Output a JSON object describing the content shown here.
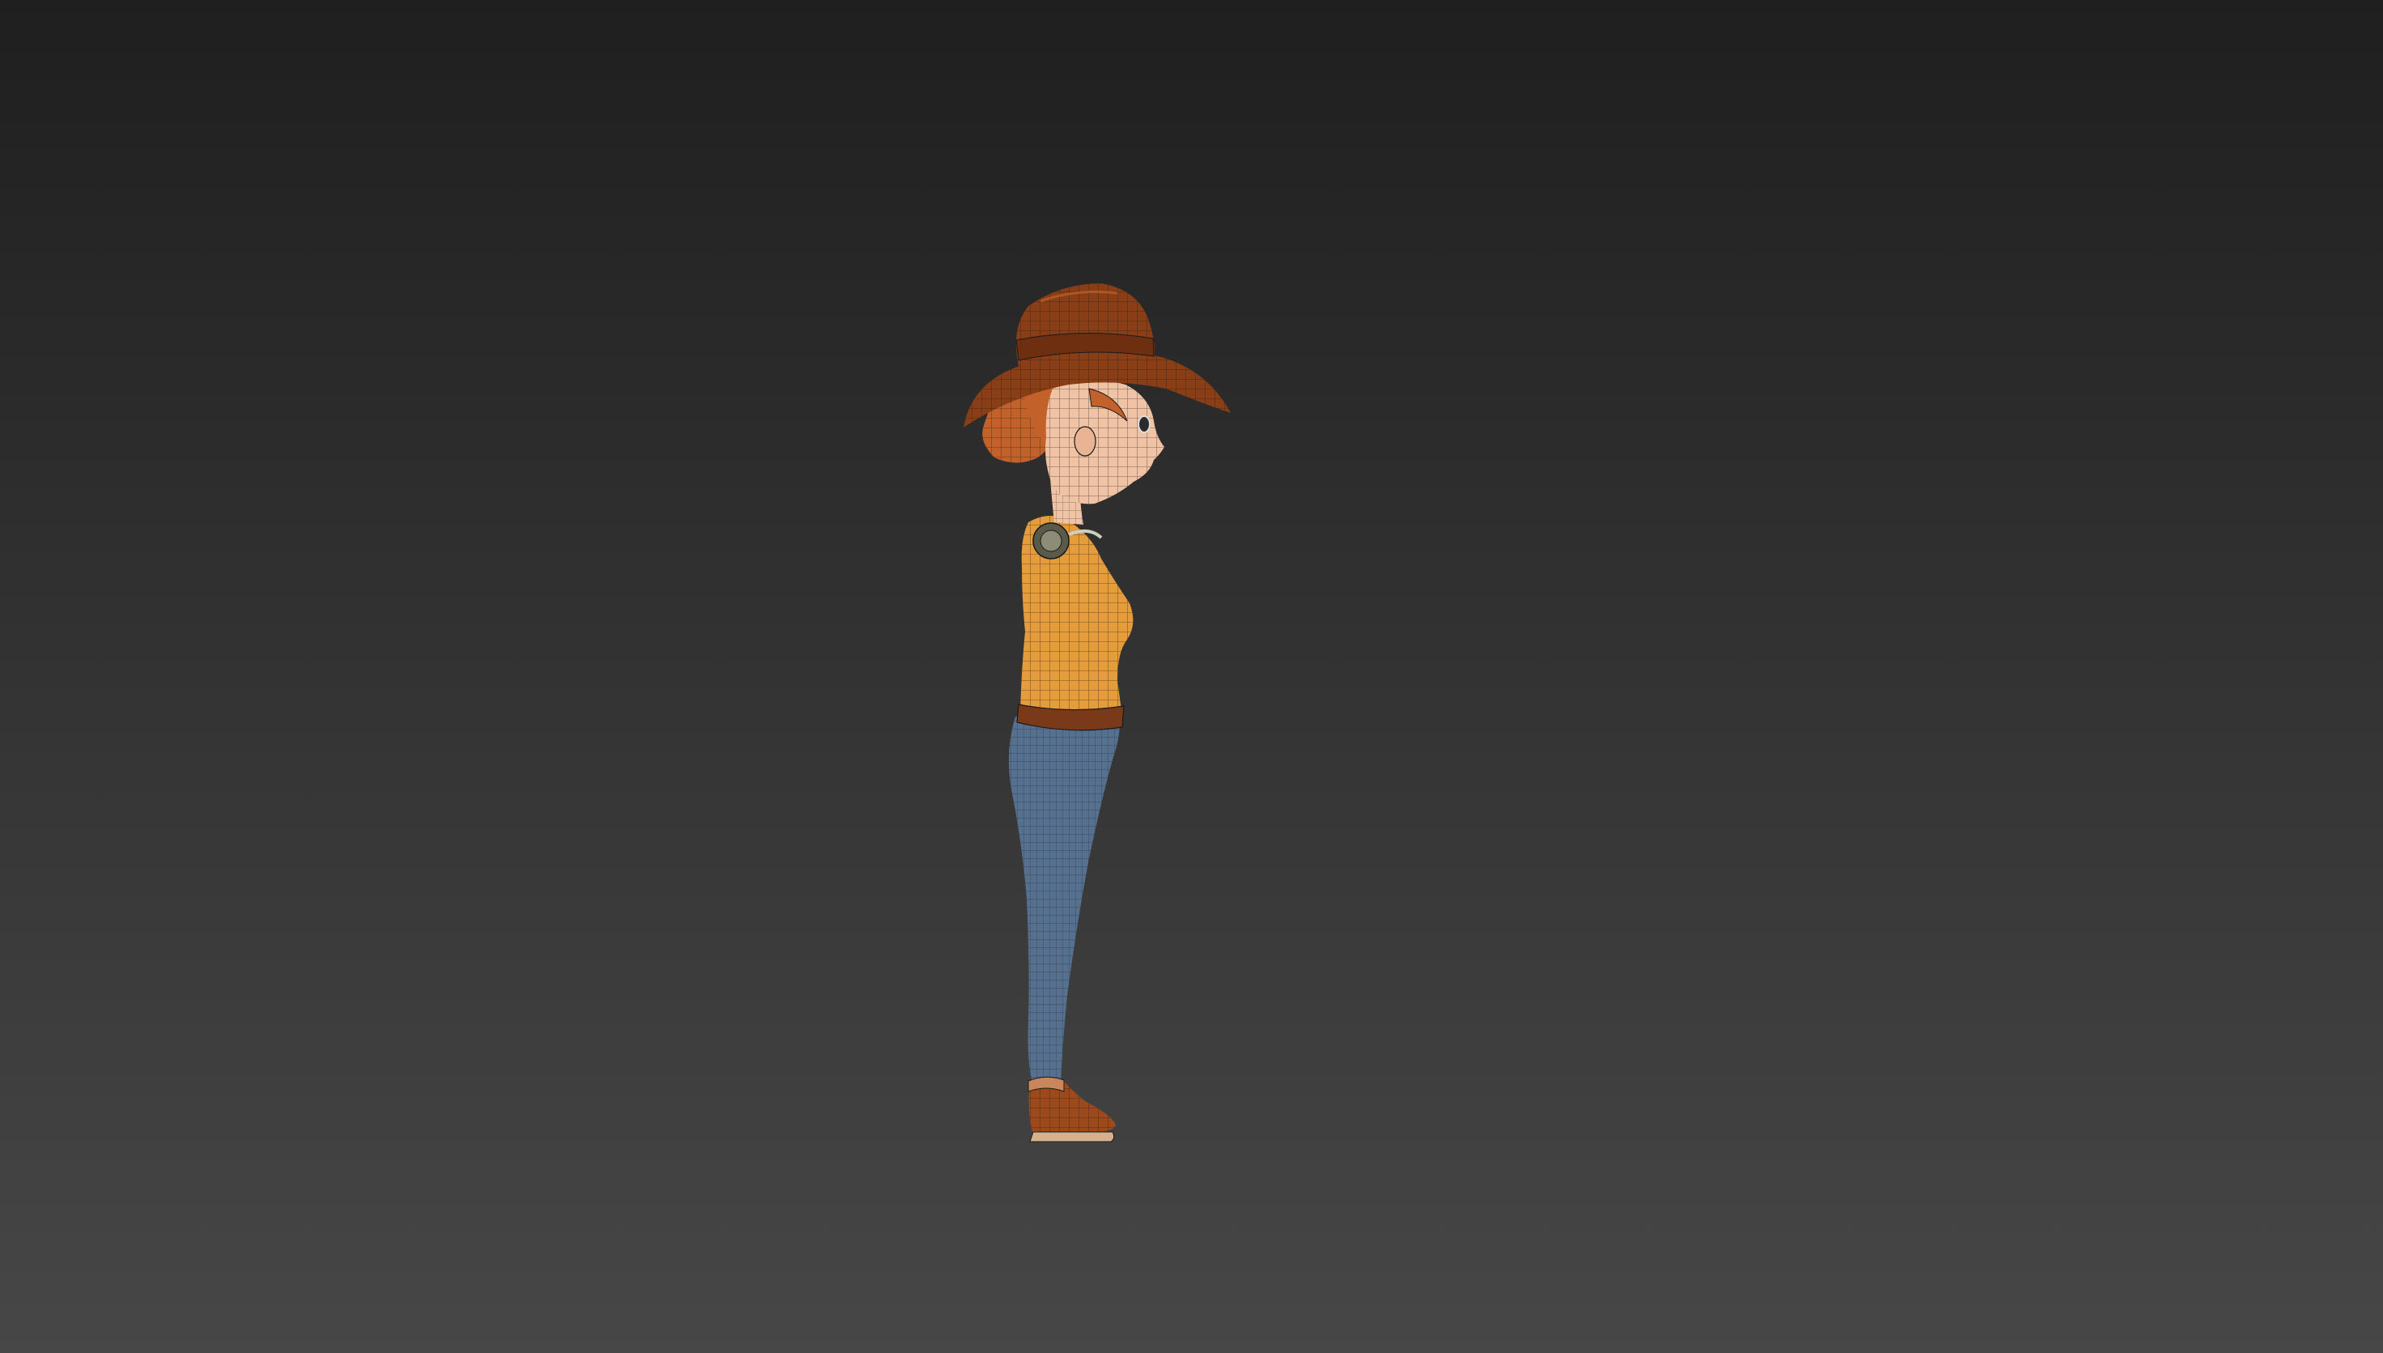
{
  "viewport": {
    "background_top": "#1f1f1f",
    "background_bottom": "#474747",
    "shading_mode": "smooth-with-wireframe",
    "view": "side"
  },
  "character": {
    "label_text": "",
    "colors": {
      "hat": "#8a3e16",
      "hat_highlight": "#c0642a",
      "hair": "#c2612a",
      "skin": "#f0c3a4",
      "shirt": "#e59c3a",
      "belt": "#7a3a1a",
      "jeans": "#56708f",
      "boots": "#9c4a1c",
      "wire": "#1a1a1a"
    }
  }
}
